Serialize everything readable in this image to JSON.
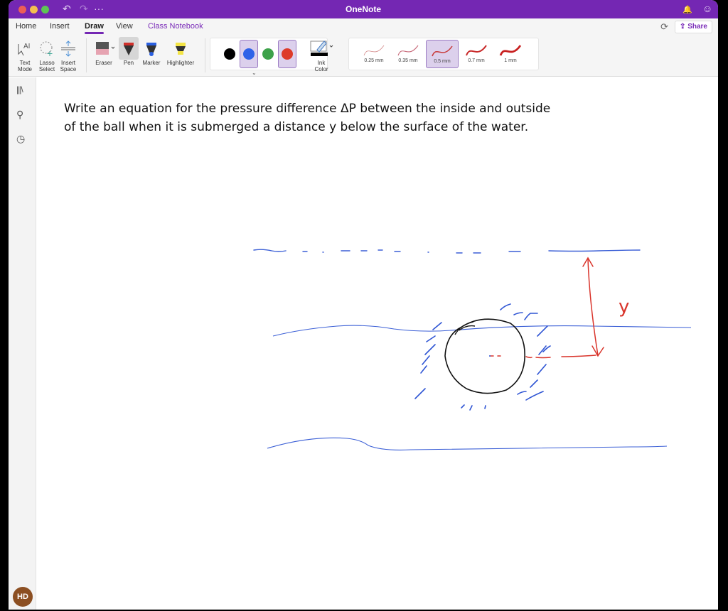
{
  "window": {
    "title": "OneNote",
    "icons": [
      "undo-icon",
      "redo-icon",
      "more-icon",
      "bell-icon",
      "smiley-icon"
    ]
  },
  "tabs": [
    {
      "label": "Home"
    },
    {
      "label": "Insert"
    },
    {
      "label": "Draw",
      "active": true
    },
    {
      "label": "View"
    },
    {
      "label": "Class Notebook"
    }
  ],
  "toolbar": {
    "sync_icon": "sync-icon",
    "share_label": "Share"
  },
  "ribbon": {
    "text_mode": {
      "line1": "Text",
      "line2": "Mode"
    },
    "lasso_select": {
      "line1": "Lasso",
      "line2": "Select"
    },
    "insert_space": {
      "line1": "Insert",
      "line2": "Space"
    },
    "eraser": "Eraser",
    "pen": "Pen",
    "marker": "Marker",
    "highlighter": "Highlighter",
    "ink_color": {
      "line1": "Ink",
      "line2": "Color"
    },
    "colors": [
      {
        "name": "black",
        "hex": "#000000",
        "selected": false
      },
      {
        "name": "blue",
        "hex": "#2f62e8",
        "selected": true
      },
      {
        "name": "green",
        "hex": "#3da24a",
        "selected": false
      },
      {
        "name": "red",
        "hex": "#dd3a2a",
        "selected": true
      }
    ],
    "thicknesses": [
      {
        "label": "0.25 mm",
        "selected": false
      },
      {
        "label": "0.35 mm",
        "selected": false
      },
      {
        "label": "0.5 mm",
        "selected": true
      },
      {
        "label": "0.7 mm",
        "selected": false
      },
      {
        "label": "1 mm",
        "selected": false
      }
    ]
  },
  "sidebar": {
    "icons": [
      "notebooks-icon",
      "search-icon",
      "recent-icon"
    ],
    "avatar_initials": "HD"
  },
  "page": {
    "question_line1": "Write an equation for the pressure difference ΔP between the inside and outside",
    "question_line2": "of the ball when it is submerged a distance y below the surface of the water.",
    "ink_label": "y"
  },
  "colors": {
    "accent": "#7427b3",
    "ink_blue": "#3b5fd6",
    "ink_red": "#d9342b",
    "ink_black": "#111111"
  }
}
